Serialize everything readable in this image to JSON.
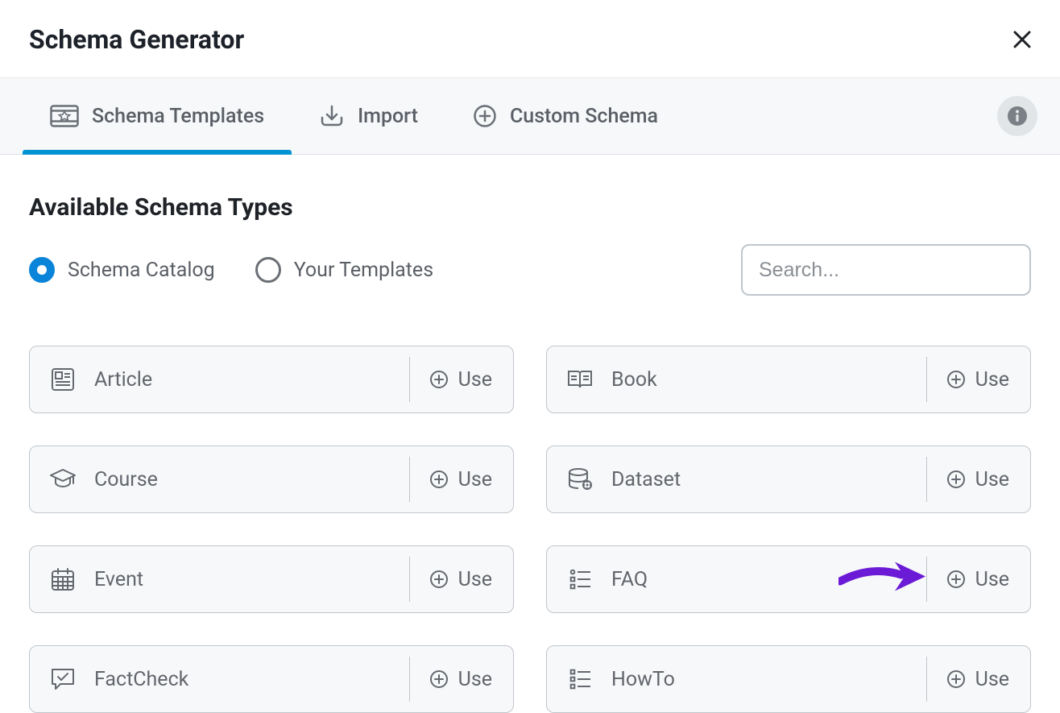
{
  "dialog": {
    "title": "Schema Generator"
  },
  "tabs": [
    {
      "label": "Schema Templates",
      "active": true
    },
    {
      "label": "Import",
      "active": false
    },
    {
      "label": "Custom Schema",
      "active": false
    }
  ],
  "section": {
    "title": "Available Schema Types"
  },
  "filters": {
    "options": [
      {
        "label": "Schema Catalog",
        "selected": true
      },
      {
        "label": "Your Templates",
        "selected": false
      }
    ],
    "search_placeholder": "Search..."
  },
  "grid": {
    "use_label": "Use",
    "cards": [
      {
        "name": "Article",
        "icon": "article-icon"
      },
      {
        "name": "Book",
        "icon": "book-icon"
      },
      {
        "name": "Course",
        "icon": "course-icon"
      },
      {
        "name": "Dataset",
        "icon": "dataset-icon"
      },
      {
        "name": "Event",
        "icon": "event-icon"
      },
      {
        "name": "FAQ",
        "icon": "faq-icon",
        "annotated": true
      },
      {
        "name": "FactCheck",
        "icon": "factcheck-icon"
      },
      {
        "name": "HowTo",
        "icon": "howto-icon"
      }
    ]
  },
  "colors": {
    "accent": "#0093d1",
    "annotation": "#6b1bd6"
  }
}
